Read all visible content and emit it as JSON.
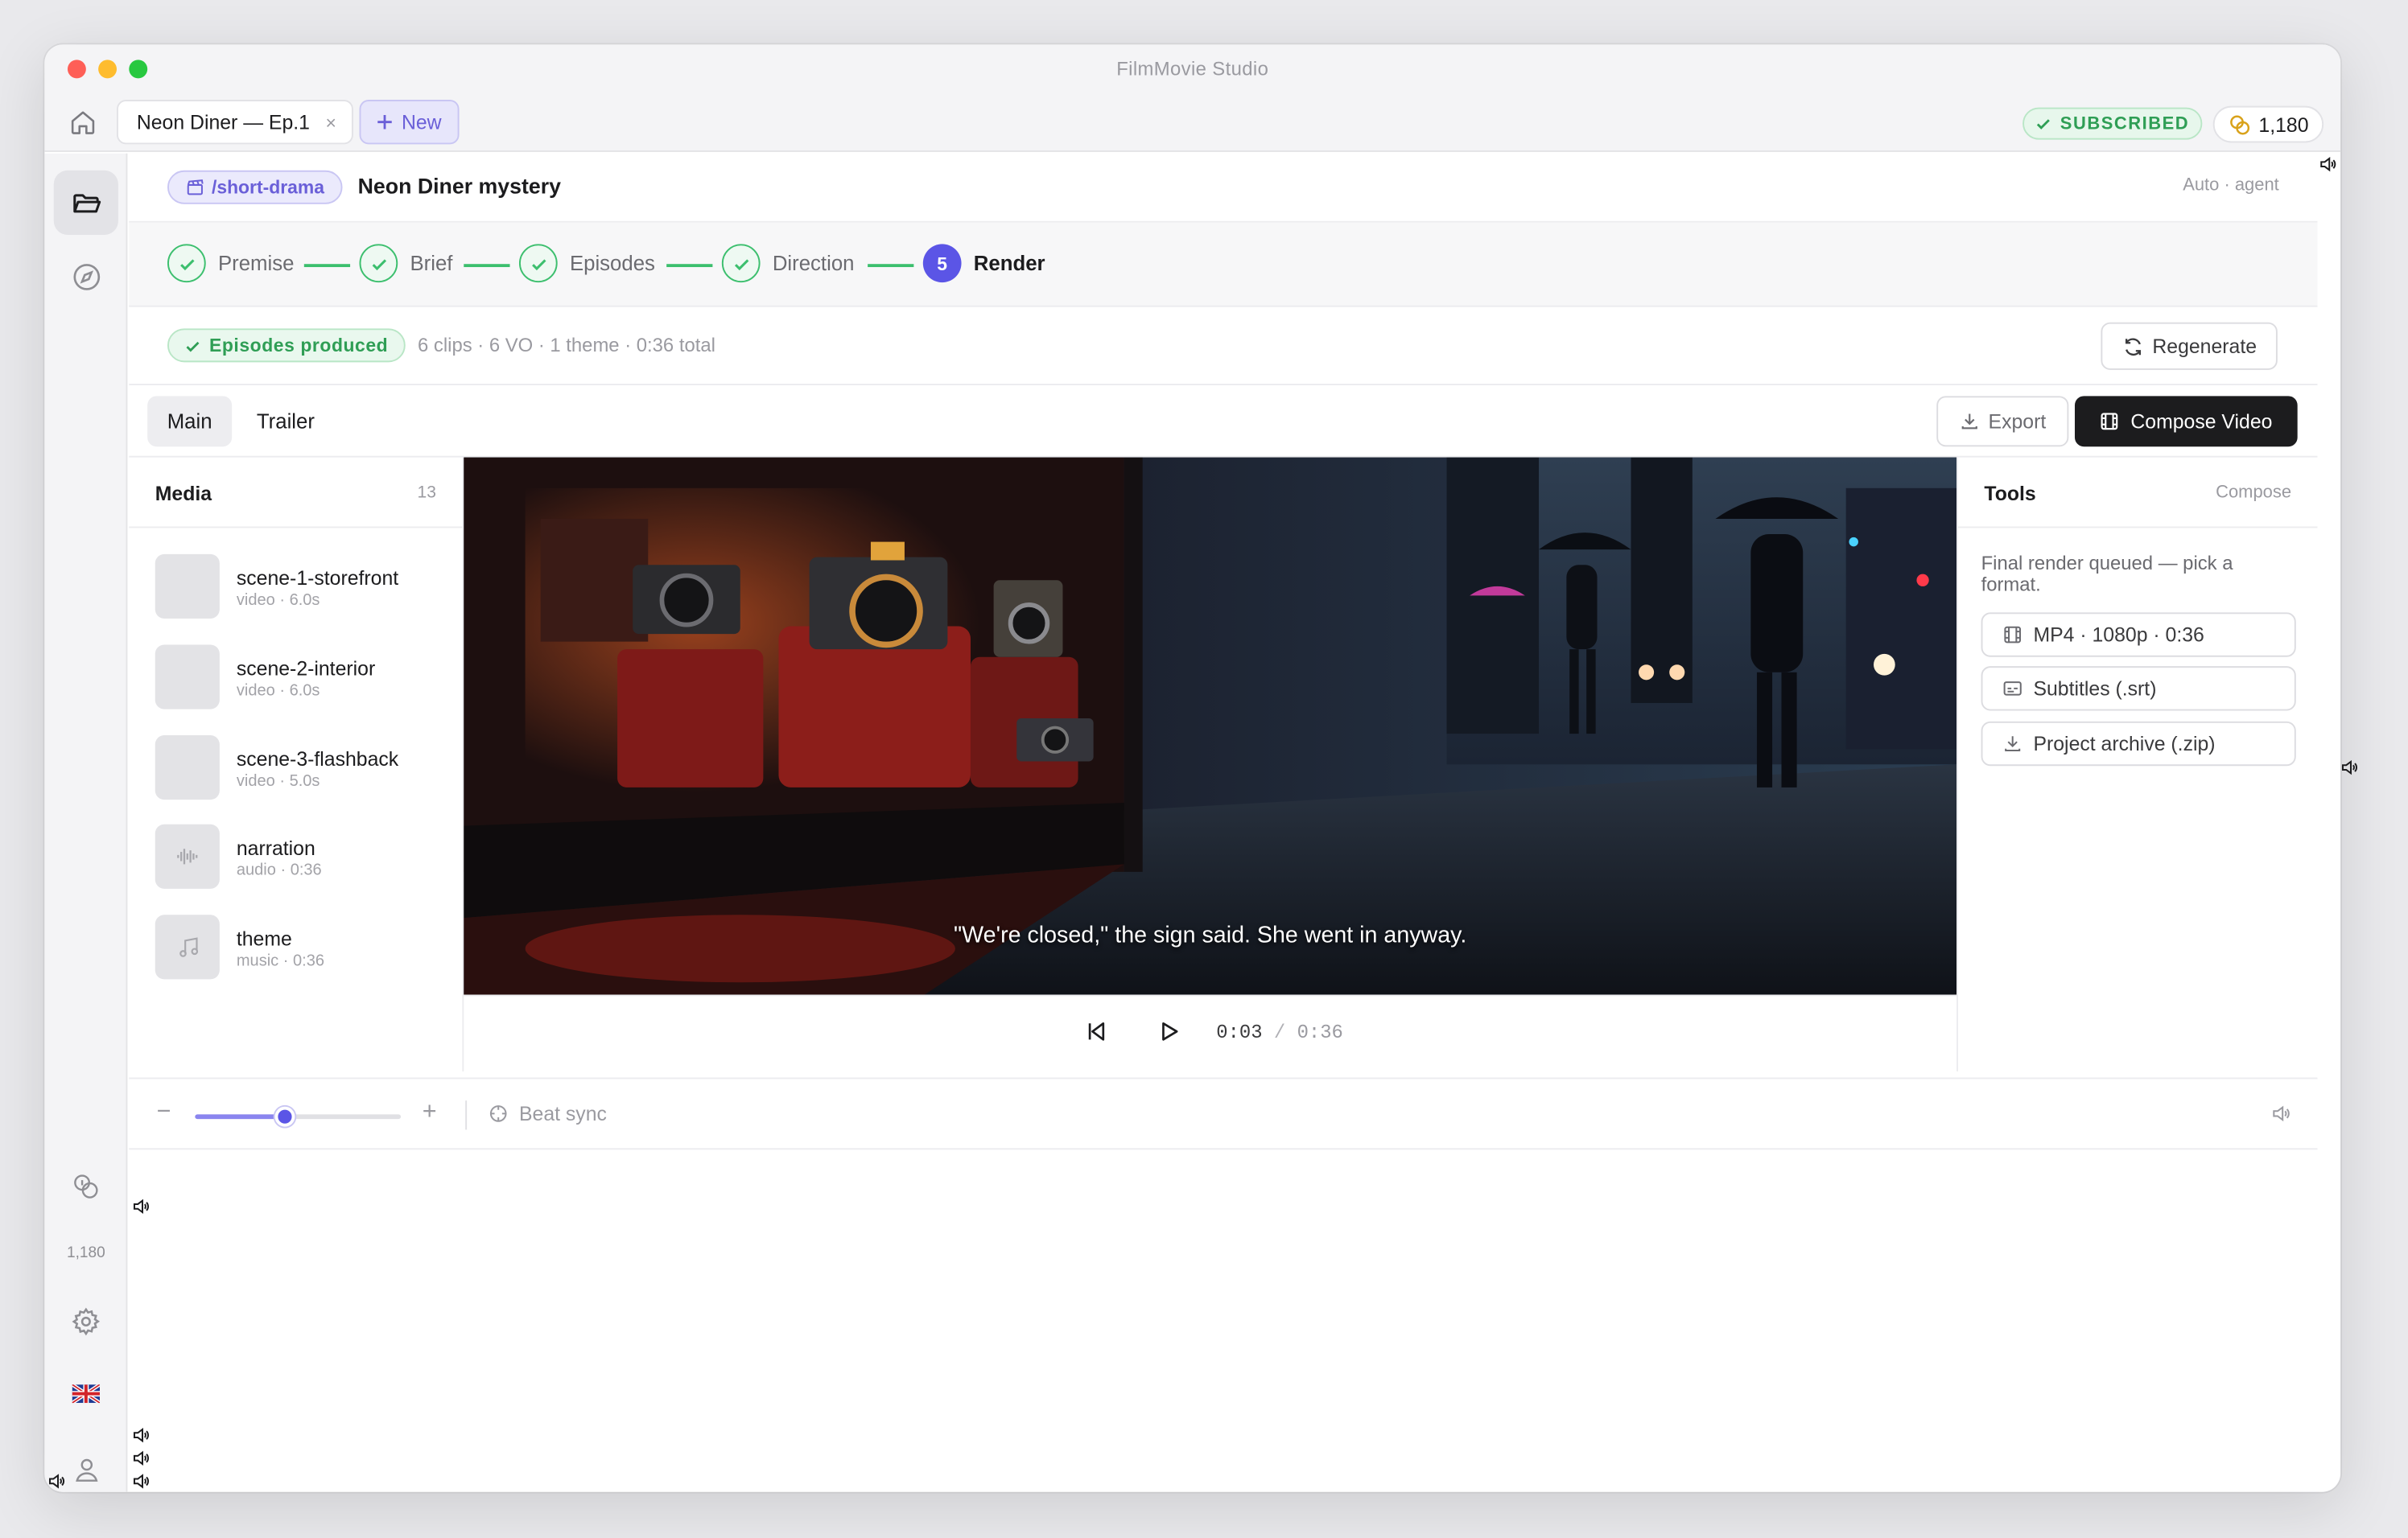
{
  "window": {
    "title": "FilmMovie Studio",
    "traffic_colors": [
      "#fe5f57",
      "#febc2e",
      "#28c840"
    ]
  },
  "tabbar": {
    "home_icon": "home-icon",
    "tab_label": "Neon Diner — Ep.1",
    "tab_close": "×",
    "new_tab_label": "New",
    "subscription_badge": "SUBSCRIBED",
    "credits": "1,180"
  },
  "sidebar": {
    "items": [
      {
        "icon": "folder-open-icon",
        "active": true
      },
      {
        "icon": "compass-icon",
        "active": false
      }
    ],
    "credits_label": "1,180",
    "bottom_icons": [
      "coins-icon",
      "gear-icon",
      "uk-flag-icon",
      "user-icon"
    ]
  },
  "project": {
    "command": "/short-drama",
    "title": "Neon Diner mystery",
    "mode": "Auto · agent"
  },
  "steps": [
    {
      "label": "Premise",
      "state": "done"
    },
    {
      "label": "Brief",
      "state": "done"
    },
    {
      "label": "Episodes",
      "state": "done"
    },
    {
      "label": "Direction",
      "state": "done"
    },
    {
      "label": "Render",
      "state": "current",
      "number": "5"
    }
  ],
  "status": {
    "badge": "Episodes produced",
    "summary": "6 clips · 6 VO · 1 theme · 0:36 total",
    "regenerate_label": "Regenerate"
  },
  "view_tabs": {
    "main": "Main",
    "trailer": "Trailer",
    "export_label": "Export",
    "compose_label": "Compose Video"
  },
  "media": {
    "title": "Media",
    "count": "13",
    "items": [
      {
        "name": "scene-1-storefront",
        "meta": "video · 6.0s",
        "icon": "video-thumb"
      },
      {
        "name": "scene-2-interior",
        "meta": "video · 6.0s",
        "icon": "video-thumb"
      },
      {
        "name": "scene-3-flashback",
        "meta": "video · 5.0s",
        "icon": "video-thumb"
      },
      {
        "name": "narration",
        "meta": "audio · 0:36",
        "icon": "waveform-icon"
      },
      {
        "name": "theme",
        "meta": "music · 0:36",
        "icon": "music-note-icon"
      }
    ]
  },
  "preview": {
    "subtitle": "\"We're closed,\" the sign said. She went in anyway.",
    "current_time": "0:03",
    "separator": "/",
    "total_time": "0:36",
    "progress": 0.083
  },
  "tools": {
    "title": "Tools",
    "mode": "Compose",
    "note": "Final render queued — pick a format.",
    "formats": [
      {
        "label": "MP4 · 1080p · 0:36",
        "icon": "film-icon"
      },
      {
        "label": "Subtitles (.srt)",
        "icon": "subtitles-icon"
      },
      {
        "label": "Project archive (.zip)",
        "icon": "download-icon"
      }
    ]
  },
  "timeline": {
    "zoom_minus": "−",
    "zoom_plus": "+",
    "zoom_level": 0.44,
    "beat_sync_label": "Beat sync"
  },
  "colors": {
    "accent": "#5b55e6",
    "success": "#3cbf6e",
    "dark": "#1c1c1e"
  }
}
